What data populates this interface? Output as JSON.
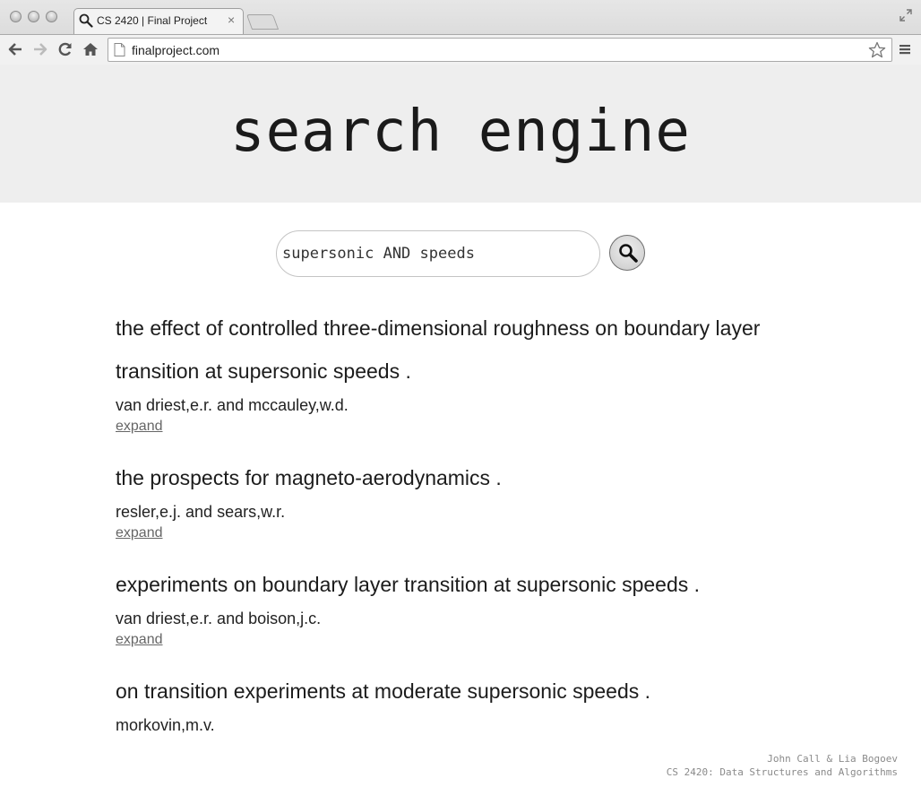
{
  "browser": {
    "tab_title": "CS 2420 | Final Project",
    "tab_close": "×",
    "url": "finalproject.com"
  },
  "page": {
    "title": "search engine",
    "search": {
      "value": "supersonic AND speeds"
    },
    "results": [
      {
        "title": "the effect of controlled three-dimensional roughness on boundary layer transition at supersonic speeds .",
        "authors": "van driest,e.r. and mccauley,w.d.",
        "expand": "expand"
      },
      {
        "title": "the prospects for magneto-aerodynamics .",
        "authors": "resler,e.j. and sears,w.r.",
        "expand": "expand"
      },
      {
        "title": "experiments on boundary layer transition at supersonic speeds .",
        "authors": "van driest,e.r. and boison,j.c.",
        "expand": "expand"
      },
      {
        "title": "on transition experiments at moderate supersonic speeds .",
        "authors": "morkovin,m.v.",
        "expand": ""
      }
    ],
    "footer": {
      "line1": "John Call & Lia Bogoev",
      "line2": "CS 2420: Data Structures and Algorithms"
    }
  }
}
